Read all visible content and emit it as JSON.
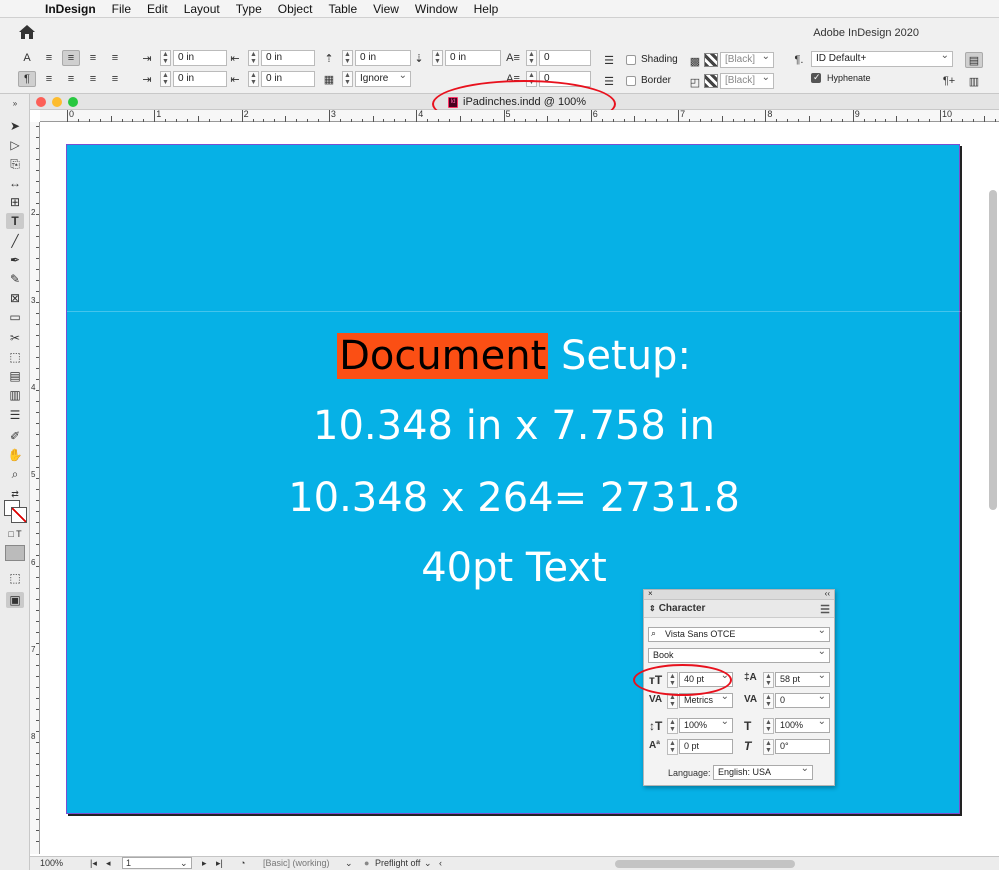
{
  "menubar": {
    "apple": "",
    "items": [
      "InDesign",
      "File",
      "Edit",
      "Layout",
      "Type",
      "Object",
      "Table",
      "View",
      "Window",
      "Help"
    ]
  },
  "control": {
    "app_title": "Adobe InDesign 2020",
    "indent_left": "0 in",
    "indent_right": "0 in",
    "first_line": "0 in",
    "last_line": "0 in",
    "space_before": "0 in",
    "space_after": "0 in",
    "drop_cap_lines": "0",
    "drop_cap_chars": "0",
    "align_to_grid": "Ignore",
    "shading_label": "Shading",
    "border_label": "Border",
    "shading_color": "[Black]",
    "border_color": "[Black]",
    "paragraph_style": "ID Default+",
    "hyphenate_label": "Hyphenate"
  },
  "document": {
    "tab_title": "iPadinches.indd @ 100%",
    "ruler_numbers": [
      "0",
      "1",
      "2",
      "3",
      "4",
      "5",
      "6",
      "7",
      "8",
      "9",
      "10"
    ],
    "vruler_numbers": [
      "2",
      "3",
      "4",
      "5",
      "6",
      "7",
      "8"
    ],
    "highlight_word": "Document",
    "line1_rest": " Setup:",
    "line2": "10.348 in x 7.758 in",
    "line3": "10.348 x 264= 2731.8",
    "line4": "40pt Text",
    "page_color": "#06b1e6",
    "highlight_color": "#fb4f14"
  },
  "character": {
    "title": "Character",
    "font_family": "Vista Sans OTCE",
    "font_style": "Book",
    "font_size": "40 pt",
    "leading": "58 pt",
    "kerning": "Metrics",
    "tracking": "0",
    "vertical_scale": "100%",
    "horizontal_scale": "100%",
    "baseline_shift": "0 pt",
    "skew": "0°",
    "language_label": "Language:",
    "language": "English: USA"
  },
  "status": {
    "zoom": "100%",
    "page": "1",
    "style": "[Basic] (working)",
    "preflight": "Preflight off"
  },
  "annotation_color": "#e8111d"
}
